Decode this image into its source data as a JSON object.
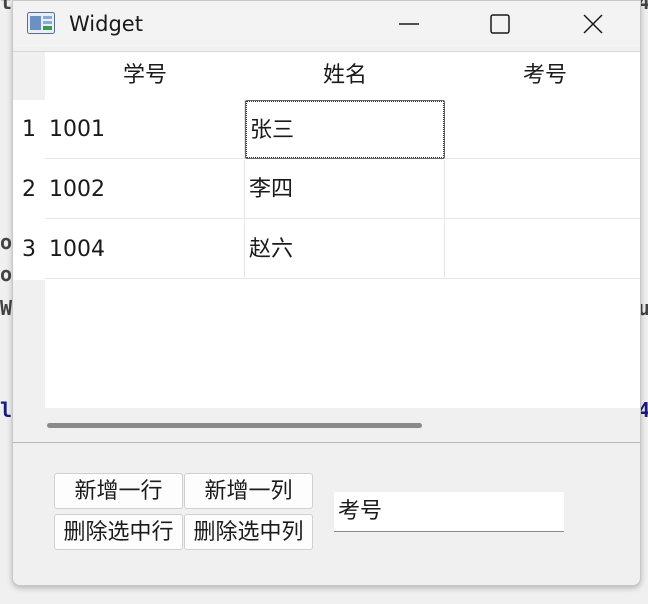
{
  "window": {
    "title": "Widget",
    "icon": "app-window-icon",
    "controls": [
      "minimize-icon",
      "maximize-icon",
      "close-icon"
    ]
  },
  "table": {
    "columns": [
      "学号",
      "姓名",
      "考号"
    ],
    "row_numbers": [
      "1",
      "2",
      "3"
    ],
    "rows": [
      [
        "1001",
        "张三",
        ""
      ],
      [
        "1002",
        "李四",
        ""
      ],
      [
        "1004",
        "赵六",
        ""
      ]
    ],
    "current_cell": {
      "row": 1,
      "column": 2
    }
  },
  "buttons": {
    "add_row": "新增一行",
    "add_column": "新增一列",
    "delete_row": "删除选中行",
    "delete_column": "删除选中列"
  },
  "input": {
    "value": "考号"
  },
  "colors": {
    "window_bg": "#f0f0f0",
    "table_bg": "#ffffff",
    "border": "#c8c8c8"
  }
}
